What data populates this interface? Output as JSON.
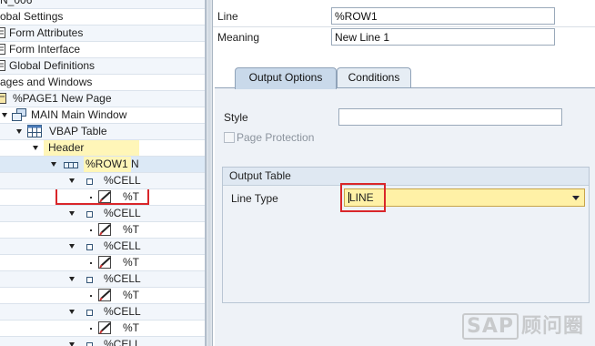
{
  "tree": {
    "rows": [
      {
        "text": "N_006"
      },
      {
        "text": "obal Settings"
      },
      {
        "text": "Form Attributes",
        "icon": "form-attributes-icon"
      },
      {
        "text": "Form Interface",
        "icon": "form-interface-icon"
      },
      {
        "text": "Global Definitions",
        "icon": "global-definitions-icon"
      },
      {
        "text": "ages and Windows"
      },
      {
        "text": "%PAGE1 New Page",
        "icon": "page-icon"
      },
      {
        "text": "MAIN Main Window",
        "icon": "window-icon"
      },
      {
        "text": "VBAP Table",
        "icon": "table-icon"
      },
      {
        "text": "Header"
      },
      {
        "text": "%ROW1 N",
        "icon": "row-icon"
      },
      {
        "text": "%CELL",
        "icon": "cell-icon"
      },
      {
        "text": "%T",
        "icon": "text-icon"
      },
      {
        "text": "%CELL",
        "icon": "cell-icon"
      },
      {
        "text": "%T",
        "icon": "text-icon"
      },
      {
        "text": "%CELL",
        "icon": "cell-icon"
      },
      {
        "text": "%T",
        "icon": "text-icon"
      },
      {
        "text": "%CELL",
        "icon": "cell-icon"
      },
      {
        "text": "%T",
        "icon": "text-icon"
      },
      {
        "text": "%CELL",
        "icon": "cell-icon"
      }
    ]
  },
  "detail": {
    "line_label": "Line",
    "line_value": "%ROW1",
    "meaning_label": "Meaning",
    "meaning_value": "New Line 1",
    "tabs": [
      {
        "label": "Output Options",
        "active": true
      },
      {
        "label": "Conditions",
        "active": false
      }
    ],
    "style_label": "Style",
    "style_value": "",
    "page_protection_label": "Page Protection",
    "page_protection_checked": false,
    "output_table": {
      "title": "Output Table",
      "line_type_label": "Line Type",
      "line_type_value": "LINE"
    }
  },
  "watermark": {
    "brand": "SAP",
    "text": "顾问圈"
  },
  "colors": {
    "selection_highlight": "#fff6b8",
    "annotation_red": "#d9262a",
    "tab_active": "#c9d9ea",
    "required_field": "#fff1a6"
  }
}
